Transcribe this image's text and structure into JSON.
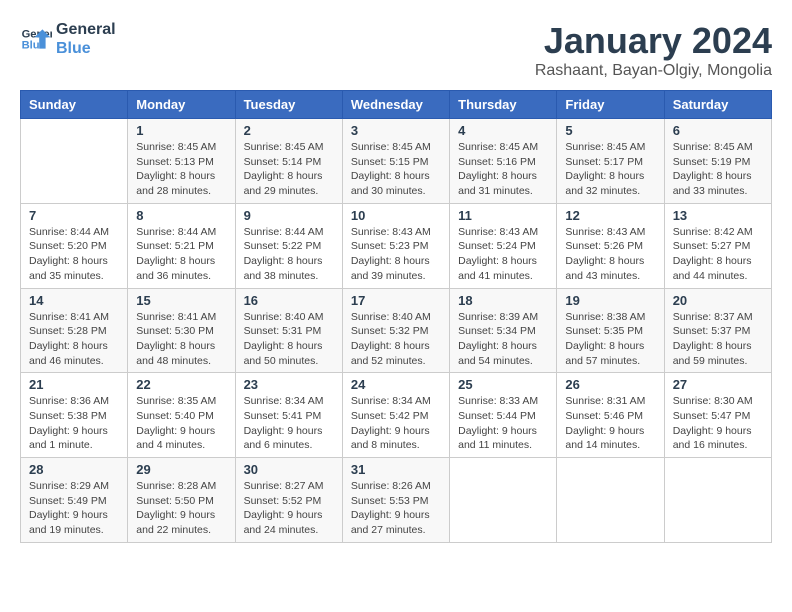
{
  "logo": {
    "line1": "General",
    "line2": "Blue"
  },
  "title": "January 2024",
  "subtitle": "Rashaant, Bayan-Olgiy, Mongolia",
  "days_of_week": [
    "Sunday",
    "Monday",
    "Tuesday",
    "Wednesday",
    "Thursday",
    "Friday",
    "Saturday"
  ],
  "weeks": [
    [
      {
        "num": "",
        "sunrise": "",
        "sunset": "",
        "daylight": ""
      },
      {
        "num": "1",
        "sunrise": "Sunrise: 8:45 AM",
        "sunset": "Sunset: 5:13 PM",
        "daylight": "Daylight: 8 hours and 28 minutes."
      },
      {
        "num": "2",
        "sunrise": "Sunrise: 8:45 AM",
        "sunset": "Sunset: 5:14 PM",
        "daylight": "Daylight: 8 hours and 29 minutes."
      },
      {
        "num": "3",
        "sunrise": "Sunrise: 8:45 AM",
        "sunset": "Sunset: 5:15 PM",
        "daylight": "Daylight: 8 hours and 30 minutes."
      },
      {
        "num": "4",
        "sunrise": "Sunrise: 8:45 AM",
        "sunset": "Sunset: 5:16 PM",
        "daylight": "Daylight: 8 hours and 31 minutes."
      },
      {
        "num": "5",
        "sunrise": "Sunrise: 8:45 AM",
        "sunset": "Sunset: 5:17 PM",
        "daylight": "Daylight: 8 hours and 32 minutes."
      },
      {
        "num": "6",
        "sunrise": "Sunrise: 8:45 AM",
        "sunset": "Sunset: 5:19 PM",
        "daylight": "Daylight: 8 hours and 33 minutes."
      }
    ],
    [
      {
        "num": "7",
        "sunrise": "Sunrise: 8:44 AM",
        "sunset": "Sunset: 5:20 PM",
        "daylight": "Daylight: 8 hours and 35 minutes."
      },
      {
        "num": "8",
        "sunrise": "Sunrise: 8:44 AM",
        "sunset": "Sunset: 5:21 PM",
        "daylight": "Daylight: 8 hours and 36 minutes."
      },
      {
        "num": "9",
        "sunrise": "Sunrise: 8:44 AM",
        "sunset": "Sunset: 5:22 PM",
        "daylight": "Daylight: 8 hours and 38 minutes."
      },
      {
        "num": "10",
        "sunrise": "Sunrise: 8:43 AM",
        "sunset": "Sunset: 5:23 PM",
        "daylight": "Daylight: 8 hours and 39 minutes."
      },
      {
        "num": "11",
        "sunrise": "Sunrise: 8:43 AM",
        "sunset": "Sunset: 5:24 PM",
        "daylight": "Daylight: 8 hours and 41 minutes."
      },
      {
        "num": "12",
        "sunrise": "Sunrise: 8:43 AM",
        "sunset": "Sunset: 5:26 PM",
        "daylight": "Daylight: 8 hours and 43 minutes."
      },
      {
        "num": "13",
        "sunrise": "Sunrise: 8:42 AM",
        "sunset": "Sunset: 5:27 PM",
        "daylight": "Daylight: 8 hours and 44 minutes."
      }
    ],
    [
      {
        "num": "14",
        "sunrise": "Sunrise: 8:41 AM",
        "sunset": "Sunset: 5:28 PM",
        "daylight": "Daylight: 8 hours and 46 minutes."
      },
      {
        "num": "15",
        "sunrise": "Sunrise: 8:41 AM",
        "sunset": "Sunset: 5:30 PM",
        "daylight": "Daylight: 8 hours and 48 minutes."
      },
      {
        "num": "16",
        "sunrise": "Sunrise: 8:40 AM",
        "sunset": "Sunset: 5:31 PM",
        "daylight": "Daylight: 8 hours and 50 minutes."
      },
      {
        "num": "17",
        "sunrise": "Sunrise: 8:40 AM",
        "sunset": "Sunset: 5:32 PM",
        "daylight": "Daylight: 8 hours and 52 minutes."
      },
      {
        "num": "18",
        "sunrise": "Sunrise: 8:39 AM",
        "sunset": "Sunset: 5:34 PM",
        "daylight": "Daylight: 8 hours and 54 minutes."
      },
      {
        "num": "19",
        "sunrise": "Sunrise: 8:38 AM",
        "sunset": "Sunset: 5:35 PM",
        "daylight": "Daylight: 8 hours and 57 minutes."
      },
      {
        "num": "20",
        "sunrise": "Sunrise: 8:37 AM",
        "sunset": "Sunset: 5:37 PM",
        "daylight": "Daylight: 8 hours and 59 minutes."
      }
    ],
    [
      {
        "num": "21",
        "sunrise": "Sunrise: 8:36 AM",
        "sunset": "Sunset: 5:38 PM",
        "daylight": "Daylight: 9 hours and 1 minute."
      },
      {
        "num": "22",
        "sunrise": "Sunrise: 8:35 AM",
        "sunset": "Sunset: 5:40 PM",
        "daylight": "Daylight: 9 hours and 4 minutes."
      },
      {
        "num": "23",
        "sunrise": "Sunrise: 8:34 AM",
        "sunset": "Sunset: 5:41 PM",
        "daylight": "Daylight: 9 hours and 6 minutes."
      },
      {
        "num": "24",
        "sunrise": "Sunrise: 8:34 AM",
        "sunset": "Sunset: 5:42 PM",
        "daylight": "Daylight: 9 hours and 8 minutes."
      },
      {
        "num": "25",
        "sunrise": "Sunrise: 8:33 AM",
        "sunset": "Sunset: 5:44 PM",
        "daylight": "Daylight: 9 hours and 11 minutes."
      },
      {
        "num": "26",
        "sunrise": "Sunrise: 8:31 AM",
        "sunset": "Sunset: 5:46 PM",
        "daylight": "Daylight: 9 hours and 14 minutes."
      },
      {
        "num": "27",
        "sunrise": "Sunrise: 8:30 AM",
        "sunset": "Sunset: 5:47 PM",
        "daylight": "Daylight: 9 hours and 16 minutes."
      }
    ],
    [
      {
        "num": "28",
        "sunrise": "Sunrise: 8:29 AM",
        "sunset": "Sunset: 5:49 PM",
        "daylight": "Daylight: 9 hours and 19 minutes."
      },
      {
        "num": "29",
        "sunrise": "Sunrise: 8:28 AM",
        "sunset": "Sunset: 5:50 PM",
        "daylight": "Daylight: 9 hours and 22 minutes."
      },
      {
        "num": "30",
        "sunrise": "Sunrise: 8:27 AM",
        "sunset": "Sunset: 5:52 PM",
        "daylight": "Daylight: 9 hours and 24 minutes."
      },
      {
        "num": "31",
        "sunrise": "Sunrise: 8:26 AM",
        "sunset": "Sunset: 5:53 PM",
        "daylight": "Daylight: 9 hours and 27 minutes."
      },
      {
        "num": "",
        "sunrise": "",
        "sunset": "",
        "daylight": ""
      },
      {
        "num": "",
        "sunrise": "",
        "sunset": "",
        "daylight": ""
      },
      {
        "num": "",
        "sunrise": "",
        "sunset": "",
        "daylight": ""
      }
    ]
  ]
}
